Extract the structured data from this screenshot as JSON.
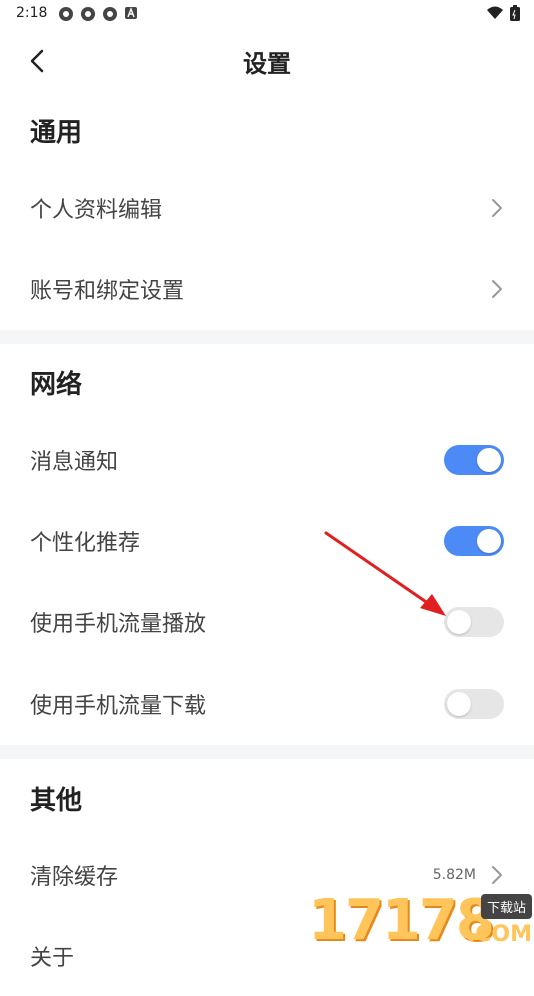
{
  "status_bar": {
    "time": "2:18"
  },
  "header": {
    "title": "设置"
  },
  "sections": {
    "general": {
      "title": "通用",
      "items": [
        {
          "label": "个人资料编辑"
        },
        {
          "label": "账号和绑定设置"
        }
      ]
    },
    "network": {
      "title": "网络",
      "items": [
        {
          "label": "消息通知",
          "enabled": true
        },
        {
          "label": "个性化推荐",
          "enabled": true
        },
        {
          "label": "使用手机流量播放",
          "enabled": false
        },
        {
          "label": "使用手机流量下载",
          "enabled": false
        }
      ]
    },
    "other": {
      "title": "其他",
      "items": [
        {
          "label": "清除缓存",
          "value": "5.82M"
        },
        {
          "label": "关于"
        }
      ]
    }
  },
  "colors": {
    "toggle_on": "#4c8bf5",
    "toggle_off": "#e6e6e6",
    "divider": "#f5f6f8",
    "annotation_arrow": "#e02020"
  },
  "watermark": {
    "number": "17178",
    "tag": "下载站",
    "suffix": ".COM"
  }
}
